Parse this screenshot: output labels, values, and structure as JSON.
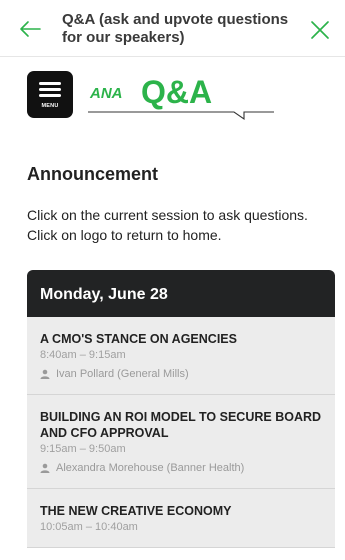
{
  "header": {
    "title": "Q&A (ask and upvote questions for our speakers)"
  },
  "menu": {
    "label": "MENU"
  },
  "logo": {
    "brand": "ANA",
    "text": "Q&A"
  },
  "announcement": {
    "heading": "Announcement",
    "body": "Click on the current session to ask questions. Click on logo to return to home."
  },
  "schedule": {
    "day": "Monday, June 28",
    "sessions": [
      {
        "title": "A CMO'S STANCE ON AGENCIES",
        "time": "8:40am – 9:15am",
        "speaker": "Ivan Pollard (General Mills)"
      },
      {
        "title": "BUILDING AN ROI MODEL TO SECURE BOARD AND CFO APPROVAL",
        "time": "9:15am – 9:50am",
        "speaker": "Alexandra Morehouse (Banner Health)"
      },
      {
        "title": "THE NEW CREATIVE ECONOMY",
        "time": "10:05am – 10:40am",
        "speaker": ""
      }
    ]
  },
  "colors": {
    "accent_green": "#2cb34a",
    "header_dark": "#222324",
    "session_bg": "#ececec"
  }
}
